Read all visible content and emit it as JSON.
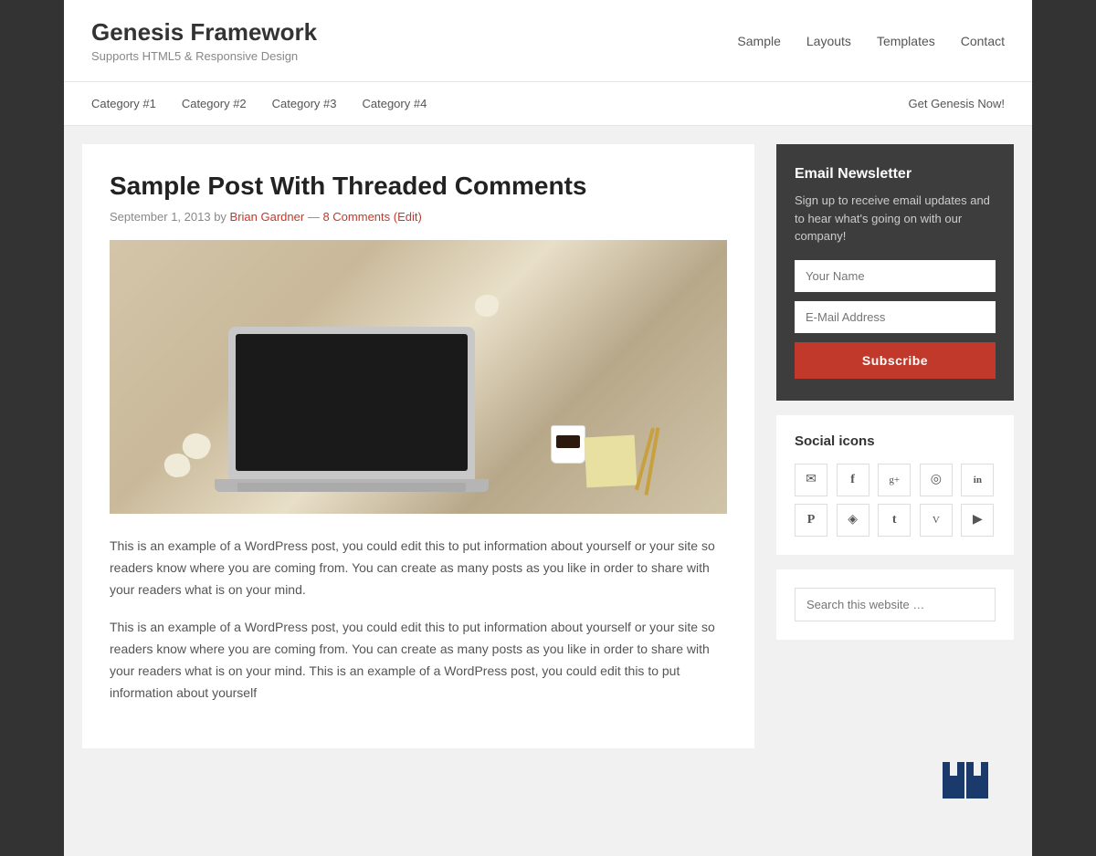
{
  "site": {
    "title": "Genesis Framework",
    "description": "Supports HTML5 & Responsive Design"
  },
  "primary_nav": {
    "items": [
      {
        "label": "Sample",
        "href": "#"
      },
      {
        "label": "Layouts",
        "href": "#"
      },
      {
        "label": "Templates",
        "href": "#"
      },
      {
        "label": "Contact",
        "href": "#"
      }
    ]
  },
  "secondary_nav": {
    "items": [
      {
        "label": "Category #1",
        "href": "#"
      },
      {
        "label": "Category #2",
        "href": "#"
      },
      {
        "label": "Category #3",
        "href": "#"
      },
      {
        "label": "Category #4",
        "href": "#"
      }
    ],
    "cta_label": "Get Genesis Now!"
  },
  "post": {
    "title": "Sample Post With Threaded Comments",
    "date": "September 1, 2013",
    "author": "Brian Gardner",
    "comments": "8 Comments",
    "edit": "(Edit)",
    "body_1": "This is an example of a WordPress post, you could edit this to put information about yourself or your site so readers know where you are coming from. You can create as many posts as you like in order to share with your readers what is on your mind.",
    "body_2": "This is an example of a WordPress post, you could edit this to put information about yourself or your site so readers know where you are coming from. You can create as many posts as you like in order to share with your readers what is on your mind. This is an example of a WordPress post, you could edit this to put information about yourself"
  },
  "sidebar": {
    "email_widget": {
      "title": "Email Newsletter",
      "description": "Sign up to receive email updates and to hear what's going on with our company!",
      "name_placeholder": "Your Name",
      "email_placeholder": "E-Mail Address",
      "subscribe_label": "Subscribe"
    },
    "social_widget": {
      "title": "Social icons",
      "icons": [
        {
          "name": "email-icon",
          "symbol": "✉"
        },
        {
          "name": "facebook-icon",
          "symbol": "f"
        },
        {
          "name": "googleplus-icon",
          "symbol": "g+"
        },
        {
          "name": "instagram-icon",
          "symbol": "◎"
        },
        {
          "name": "linkedin-icon",
          "symbol": "in"
        },
        {
          "name": "pinterest-icon",
          "symbol": "P"
        },
        {
          "name": "rss-icon",
          "symbol": "◈"
        },
        {
          "name": "twitter-icon",
          "symbol": "t"
        },
        {
          "name": "vimeo-icon",
          "symbol": "v"
        },
        {
          "name": "youtube-icon",
          "symbol": "▶"
        }
      ]
    },
    "search_widget": {
      "placeholder": "Search this website …"
    }
  },
  "colors": {
    "accent_red": "#c0392b",
    "dark_bg": "#3d3d3d",
    "body_bg": "#333"
  }
}
